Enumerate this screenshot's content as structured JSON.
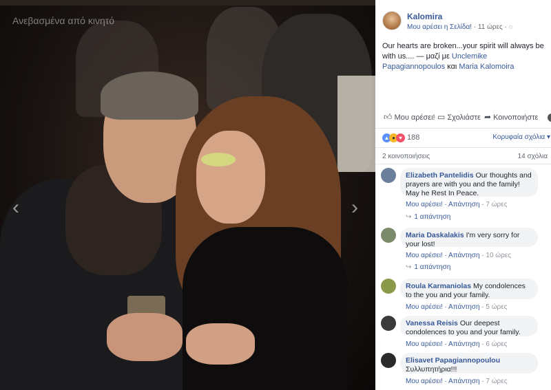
{
  "photo": {
    "watermark": "Ανεβασμένα από κινητό",
    "prev_arrow": "‹",
    "next_arrow": "›"
  },
  "post": {
    "page_name": "Kalomira",
    "meta_like_page": "Μου αρέσει η Σελίδα!",
    "meta_separator": " · ",
    "meta_time": "11 ώρες",
    "meta_globe": "◌",
    "text": "Our hearts are broken...your spirit will always be with us.... — μαζί με ",
    "tag1": "Unclemike Papagiannopoulos",
    "tag_join": " και ",
    "tag2": "Maria Kalomoira"
  },
  "actions": {
    "like": "Μου αρέσει!",
    "comment": "Σχολιάστε",
    "share": "Κοινοποιήστε"
  },
  "reactions": {
    "count": "188",
    "sort_label": "Κορυφαία σχόλια ▾"
  },
  "stats": {
    "shares": "2 κοινοποιήσεις",
    "comments": "14 σχόλια"
  },
  "comments": [
    {
      "author": "Elizabeth Pantelidis",
      "text": "Our thoughts and prayers are with you and the family! May he Rest In Peace.",
      "like": "Μου αρέσει!",
      "reply": "Απάντηση",
      "time": "7 ώρες",
      "replies": "1 απάντηση",
      "avatar_color": "#6b7f9a"
    },
    {
      "author": "Maria Daskalakis",
      "text": "I'm very sorry for your lost!",
      "like": "Μου αρέσει!",
      "reply": "Απάντηση",
      "time": "10 ώρες",
      "replies": "1 απάντηση",
      "avatar_color": "#7a8a6a"
    },
    {
      "author": "Roula Karmaniolas",
      "text": "My condolences to the you and your family.",
      "like": "Μου αρέσει!",
      "reply": "Απάντηση",
      "time": "5 ώρες",
      "replies": "",
      "avatar_color": "#8a9a4a"
    },
    {
      "author": "Vanessa Reisis",
      "text": "Our deepest condolences to you and your family.",
      "like": "Μου αρέσει!",
      "reply": "Απάντηση",
      "time": "6 ώρες",
      "replies": "",
      "avatar_color": "#3a3a3a"
    },
    {
      "author": "Elisavet Papagiannopoulou",
      "text": "Συλλυπητήρια!!!",
      "like": "Μου αρέσει!",
      "reply": "Απάντηση",
      "time": "7 ώρες",
      "replies": "",
      "avatar_color": "#2a2a2a"
    }
  ],
  "separators": {
    "dot": " · "
  }
}
